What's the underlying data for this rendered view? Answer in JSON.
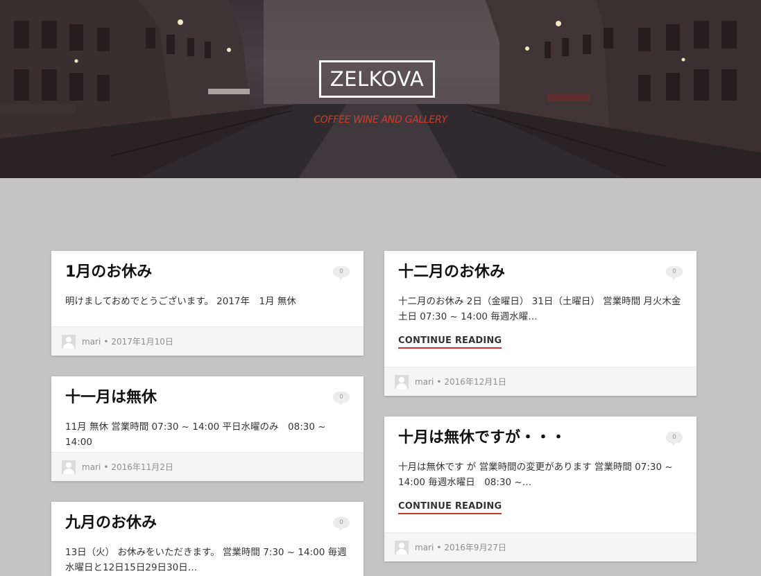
{
  "site": {
    "title": "ZELKOVA",
    "tagline": "COFFEE WINE AND GALLERY"
  },
  "posts": [
    {
      "title": "1月のお休み",
      "comments": "0",
      "excerpt": "明けましておめでとうございます。 2017年　1月 無休",
      "author": "mari",
      "date": "2017年1月10日"
    },
    {
      "title": "十二月のお休み",
      "comments": "0",
      "excerpt": "十二月のお休み 2日（金曜日） 31日（土曜日） 営業時間 月火木金土日 07:30 ~ 14:00 毎週水曜…",
      "continue_label": "CONTINUE READING",
      "author": "mari",
      "date": "2016年12月1日"
    },
    {
      "title": "十一月は無休",
      "comments": "0",
      "excerpt": "11月 無休 営業時間 07:30 ~ 14:00 平日水曜のみ　08:30 ~ 14:00",
      "author": "mari",
      "date": "2016年11月2日"
    },
    {
      "title": "十月は無休ですが・・・",
      "comments": "0",
      "excerpt": "十月は無休です が 営業時間の変更があります 営業時間 07:30 ~ 14:00 毎週水曜日　08:30 ~…",
      "continue_label": "CONTINUE READING",
      "author": "mari",
      "date": "2016年9月27日"
    },
    {
      "title": "九月のお休み",
      "comments": "0",
      "excerpt": "13日（火） お休みをいただきます。 営業時間 7:30 ~ 14:00 毎週水曜日と12日15日29日30日…"
    }
  ],
  "meta_separator": "•",
  "icons": {
    "comment": "comment-bubble-icon",
    "avatar": "default-avatar-icon"
  },
  "colors": {
    "accent": "#c0392b",
    "tagline": "#d23a2a",
    "page_bg": "#c4c4c4"
  }
}
